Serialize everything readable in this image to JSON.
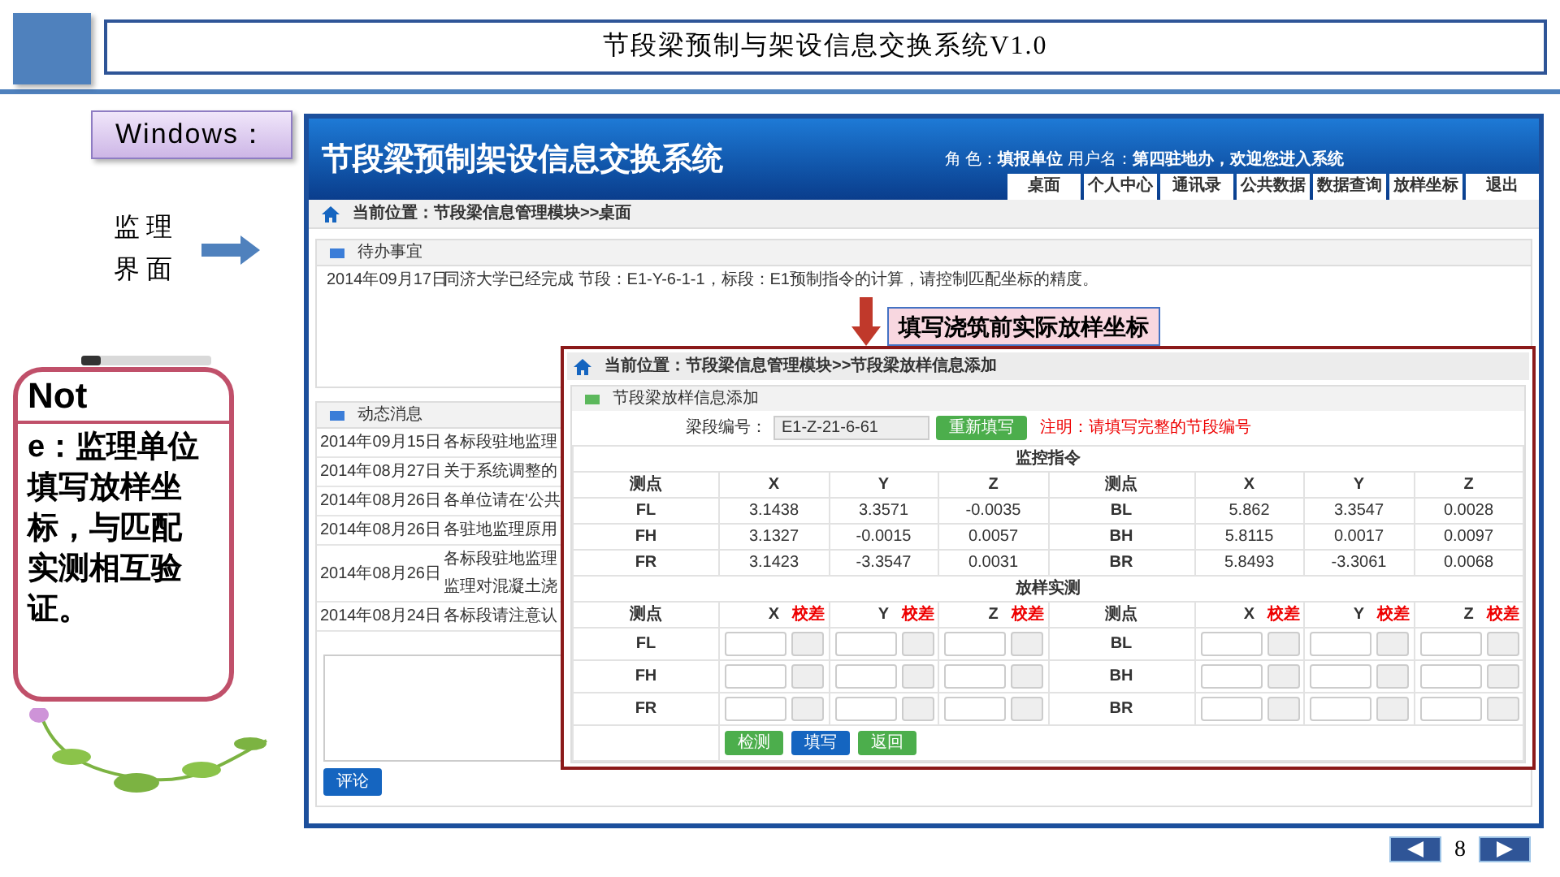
{
  "slide_title": "节段梁预制与架设信息交换系统V1.0",
  "windows_label": "Windows：",
  "side_label": [
    "监理",
    "界面"
  ],
  "note": {
    "title": "Not",
    "body": "e：监理单位填写放样坐标，与匹配实测相互验证。"
  },
  "app": {
    "title": "节段梁预制架设信息交换系统",
    "user_info": "角 色：**填报单位**  用户名：**第四驻地办，欢迎您进入系统**",
    "tabs": [
      "桌面",
      "个人中心",
      "通讯录",
      "公共数据",
      "数据查询",
      "放样坐标",
      "退出"
    ],
    "breadcrumb": "当前位置：节段梁信息管理模块>>桌面",
    "todo": {
      "title": "待办事宜",
      "items": [
        {
          "date": "2014年09月17日",
          "text": "同济大学已经完成 节段：E1-Y-6-1-1，标段：E1预制指令的计算，请控制匹配坐标的精度。"
        }
      ]
    },
    "news": {
      "title": "动态消息",
      "items": [
        {
          "date": "2014年09月15日",
          "lines": [
            "各标段驻地监理"
          ]
        },
        {
          "date": "2014年08月27日",
          "lines": [
            "关于系统调整的"
          ]
        },
        {
          "date": "2014年08月26日",
          "lines": [
            "各单位请在'公共"
          ]
        },
        {
          "date": "2014年08月26日",
          "lines": [
            "各驻地监理原用"
          ]
        },
        {
          "date": "2014年08月26日",
          "lines": [
            "各标段驻地监理",
            "监理对混凝土浇"
          ]
        },
        {
          "date": "2014年08月24日",
          "lines": [
            "各标段请注意认"
          ]
        }
      ]
    },
    "comment_button": "评论"
  },
  "callout": "填写浇筑前实际放样坐标",
  "dialog": {
    "breadcrumb": "当前位置：节段梁信息管理模块>>节段梁放样信息添加",
    "panel_title": "节段梁放样信息添加",
    "id_label": "梁段编号：",
    "id_value": "E1-Z-21-6-61",
    "refill_button": "重新填写",
    "hint": "注明：请填写完整的节段编号",
    "command_title": "监控指令",
    "command_header": [
      "测点",
      "X",
      "Y",
      "Z",
      "测点",
      "X",
      "Y",
      "Z"
    ],
    "command_rows": [
      [
        "FL",
        "3.1438",
        "3.3571",
        "-0.0035",
        "BL",
        "5.862",
        "3.3547",
        "0.0028"
      ],
      [
        "FH",
        "3.1327",
        "-0.0015",
        "0.0057",
        "BH",
        "5.8115",
        "0.0017",
        "0.0097"
      ],
      [
        "FR",
        "3.1423",
        "-3.3547",
        "0.0031",
        "BR",
        "5.8493",
        "-3.3061",
        "0.0068"
      ]
    ],
    "survey_title": "放样实测",
    "survey_header": [
      {
        "label": "测点"
      },
      {
        "label": "X",
        "note": "校差"
      },
      {
        "label": "Y",
        "note": "校差"
      },
      {
        "label": "Z",
        "note": "校差"
      },
      {
        "label": "测点"
      },
      {
        "label": "X",
        "note": "校差"
      },
      {
        "label": "Y",
        "note": "校差"
      },
      {
        "label": "Z",
        "note": "校差"
      }
    ],
    "survey_rows": [
      {
        "left": "FL",
        "right": "BL"
      },
      {
        "left": "FH",
        "right": "BH"
      },
      {
        "left": "FR",
        "right": "BR"
      }
    ],
    "buttons": [
      {
        "label": "检测",
        "kind": "success"
      },
      {
        "label": "填写",
        "kind": "primary"
      },
      {
        "label": "返回",
        "kind": "success"
      }
    ]
  },
  "page_number": "8"
}
